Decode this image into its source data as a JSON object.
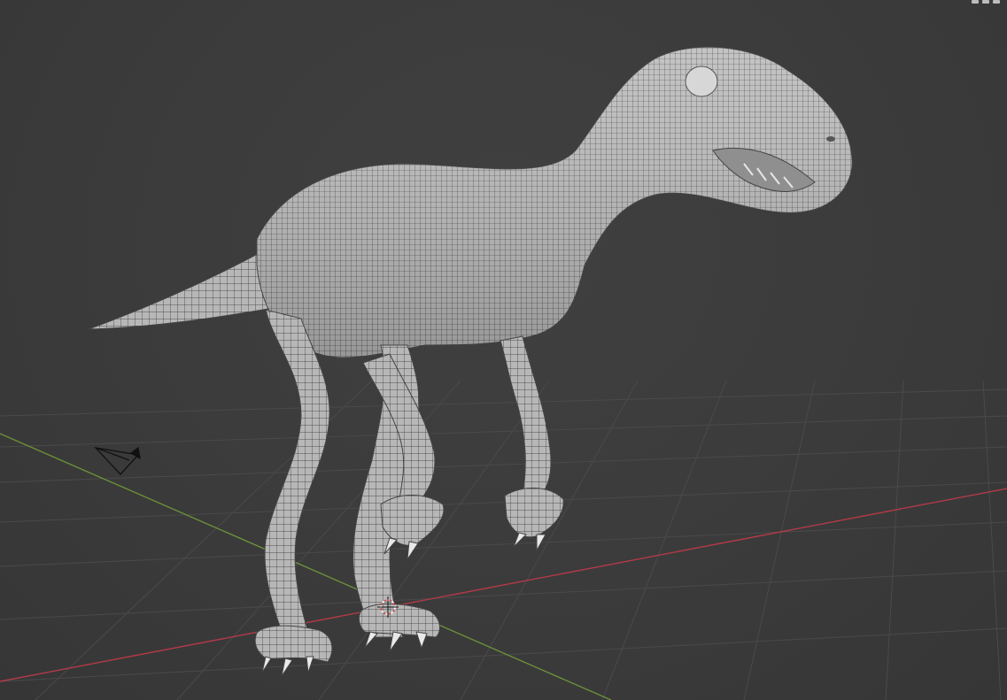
{
  "viewport": {
    "background_color": "#3c3c3c",
    "grid_color": "#4a4a4a",
    "x_axis_color": "#b23a48",
    "y_axis_color": "#6c8f3a",
    "model_color": "#b4b4b4",
    "wire_color": "#2e2e2e"
  },
  "objects": {
    "mesh": "dinosaur-mesh",
    "camera": "camera-icon",
    "origin": "3d-cursor-icon"
  }
}
